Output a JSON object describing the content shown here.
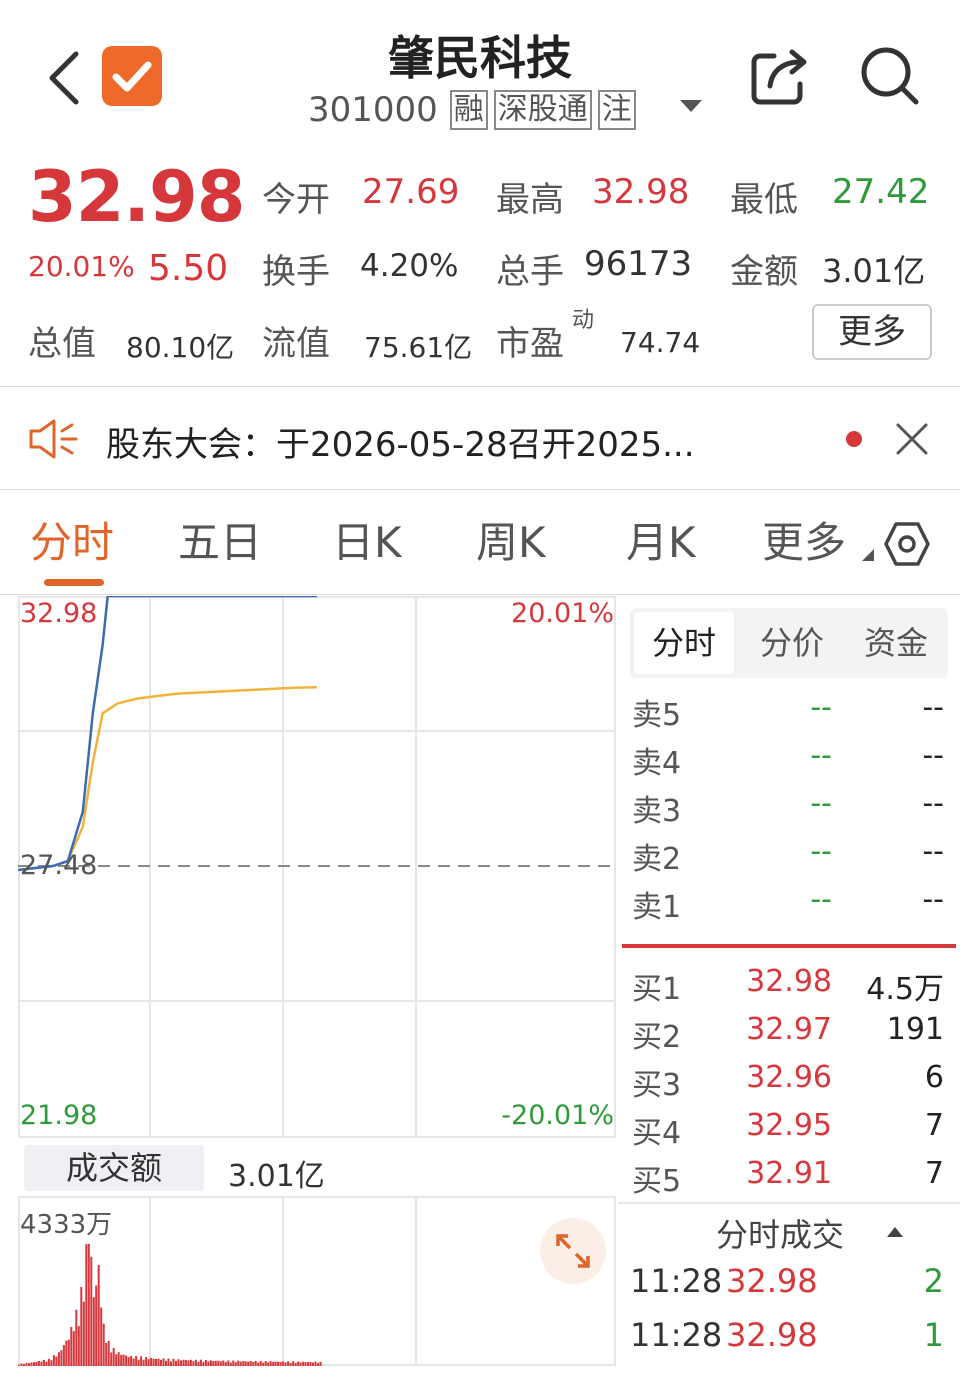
{
  "header": {
    "stock_name": "肇民科技",
    "stock_code": "301000",
    "tags": [
      "融",
      "深股通",
      "注"
    ]
  },
  "quote": {
    "price": "32.98",
    "change_pct": "20.01%",
    "change_amt": "5.50",
    "open_label": "今开",
    "open_value": "27.69",
    "high_label": "最高",
    "high_value": "32.98",
    "low_label": "最低",
    "low_value": "27.42",
    "turnover_label": "换手",
    "turnover_value": "4.20%",
    "volume_label": "总手",
    "volume_value": "96173",
    "amount_label": "金额",
    "amount_value": "3.01亿",
    "mktcap_label": "总值",
    "mktcap_value": "80.10亿",
    "float_label": "流值",
    "float_value": "75.61亿",
    "pe_label": "市盈",
    "pe_sup": "动",
    "pe_value": "74.74",
    "more_button": "更多"
  },
  "notice": {
    "text": "股东大会：于2026-05-28召开2025..."
  },
  "tabs": [
    "分时",
    "五日",
    "日K",
    "周K",
    "月K",
    "更多"
  ],
  "chart_labels": {
    "top_price": "32.98",
    "top_pct": "20.01%",
    "mid_price": "27.48",
    "bottom_price": "21.98",
    "bottom_pct": "-20.01%",
    "volume_tab": "成交额",
    "volume_total": "3.01亿",
    "volume_max": "4333万"
  },
  "book": {
    "subtabs": [
      "分时",
      "分价",
      "资金"
    ],
    "asks": [
      {
        "label": "卖5",
        "price": "--",
        "qty": "--"
      },
      {
        "label": "卖4",
        "price": "--",
        "qty": "--"
      },
      {
        "label": "卖3",
        "price": "--",
        "qty": "--"
      },
      {
        "label": "卖2",
        "price": "--",
        "qty": "--"
      },
      {
        "label": "卖1",
        "price": "--",
        "qty": "--"
      }
    ],
    "bids": [
      {
        "label": "买1",
        "price": "32.98",
        "qty": "4.5万"
      },
      {
        "label": "买2",
        "price": "32.97",
        "qty": "191"
      },
      {
        "label": "买3",
        "price": "32.96",
        "qty": "6"
      },
      {
        "label": "买4",
        "price": "32.95",
        "qty": "7"
      },
      {
        "label": "买5",
        "price": "32.91",
        "qty": "7"
      }
    ],
    "trades_title": "分时成交",
    "trades": [
      {
        "time": "11:28",
        "price": "32.98",
        "qty": "2"
      },
      {
        "time": "11:28",
        "price": "32.98",
        "qty": "1"
      }
    ]
  },
  "colors": {
    "up": "#d6373b",
    "down": "#2e9a3a",
    "accent": "#e0652b",
    "price_line": "#3d6bb3",
    "avg_line": "#f0b43c"
  },
  "chart_data": {
    "type": "line",
    "title": "",
    "ylim": [
      21.98,
      32.98
    ],
    "baseline": 27.48,
    "series": [
      {
        "name": "",
        "x": [
          0,
          14,
          20,
          26,
          30,
          34,
          36,
          40,
          44,
          48,
          52,
          56,
          60,
          66,
          72,
          80,
          88,
          96,
          104,
          112,
          120
        ],
        "values": [
          27.42,
          27.5,
          27.6,
          28.6,
          30.6,
          32.0,
          32.98,
          32.98,
          32.98,
          32.98,
          32.98,
          32.98,
          32.98,
          32.98,
          32.98,
          32.98,
          32.98,
          32.98,
          32.98,
          32.98,
          32.98
        ]
      },
      {
        "name": "",
        "x": [
          0,
          14,
          20,
          26,
          30,
          34,
          40,
          48,
          56,
          64,
          72,
          80,
          88,
          96,
          104,
          112,
          120
        ],
        "values": [
          27.42,
          27.5,
          27.6,
          28.3,
          29.6,
          30.6,
          30.8,
          30.9,
          30.95,
          31.0,
          31.02,
          31.04,
          31.06,
          31.08,
          31.1,
          31.12,
          31.13
        ]
      }
    ],
    "volume": {
      "x": [
        0,
        6,
        12,
        16,
        20,
        24,
        26,
        28,
        30,
        32,
        34,
        36,
        38,
        40,
        44,
        50,
        56,
        62,
        70,
        80,
        90,
        100,
        110,
        120
      ],
      "values": [
        60,
        120,
        200,
        400,
        900,
        1800,
        2600,
        4333,
        2200,
        3000,
        1200,
        700,
        500,
        400,
        300,
        260,
        220,
        200,
        180,
        160,
        150,
        140,
        130,
        120
      ]
    }
  }
}
